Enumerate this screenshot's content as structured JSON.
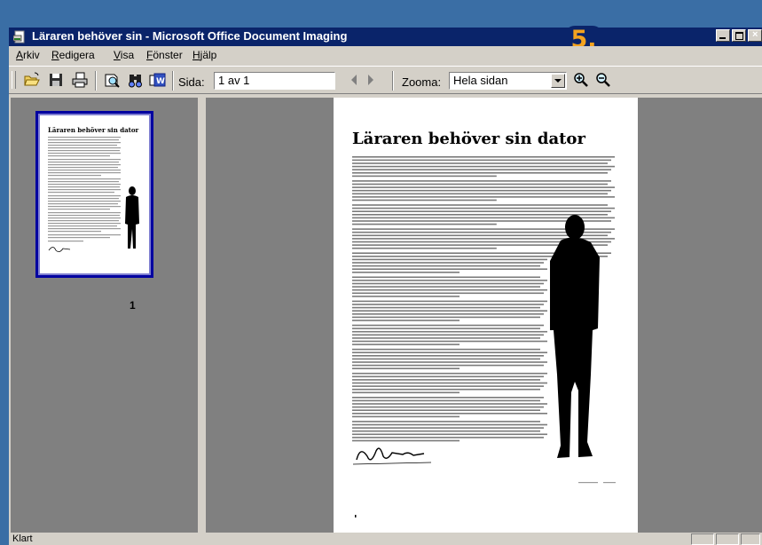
{
  "window": {
    "title": "Läraren behöver sin - Microsoft Office Document Imaging",
    "badge": "5."
  },
  "menu": [
    {
      "label": "Arkiv",
      "accel": "A",
      "rest": "rkiv"
    },
    {
      "label": "Redigera",
      "accel": "R",
      "rest": "edigera"
    },
    {
      "label": "Visa",
      "accel": "V",
      "rest": "isa"
    },
    {
      "label": "Fönster",
      "accel": "F",
      "rest": "önster"
    },
    {
      "label": "Hjälp",
      "accel": "H",
      "rest": "jälp"
    }
  ],
  "toolbar": {
    "page_label": "Sida:",
    "page_value": "1 av 1",
    "zoom_label": "Zooma:",
    "zoom_value": "Hela sidan"
  },
  "thumbnail": {
    "heading": "Läraren behöver sin dator",
    "page_number": "1"
  },
  "document": {
    "heading": "Läraren behöver sin dator"
  },
  "statusbar": {
    "text": "Klart"
  },
  "colors": {
    "desktop": "#3a6ea5",
    "titlebar": "#0a246a",
    "badge_text": "#f4a31f",
    "chrome": "#d4d0c8",
    "workspace": "#808080",
    "thumb_selection": "#0000a0"
  }
}
